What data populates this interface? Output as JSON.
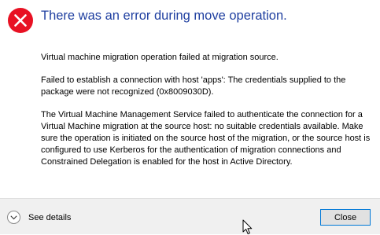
{
  "dialog": {
    "main_instruction": "There was an error during move operation.",
    "paragraphs": [
      "Virtual machine migration operation failed at migration source.",
      "Failed to establish a connection with host 'apps': The credentials supplied to the package were not recognized (0x8009030D).",
      "The Virtual Machine Management Service failed to authenticate the connection for a Virtual Machine migration at the source host: no suitable credentials available. Make sure the operation is initiated on the source host of the migration, or the source host is configured to use Kerberos for the authentication of migration connections and Constrained Delegation is enabled for the host in Active Directory."
    ],
    "icon": "error-icon",
    "icon_color": "#e81123"
  },
  "footer": {
    "details_label": "See details",
    "details_icon": "chevron-down-icon",
    "close_label": "Close"
  },
  "colors": {
    "title": "#1f3fa0",
    "footer_bg": "#f0f0f0",
    "button_border": "#0078d7"
  }
}
